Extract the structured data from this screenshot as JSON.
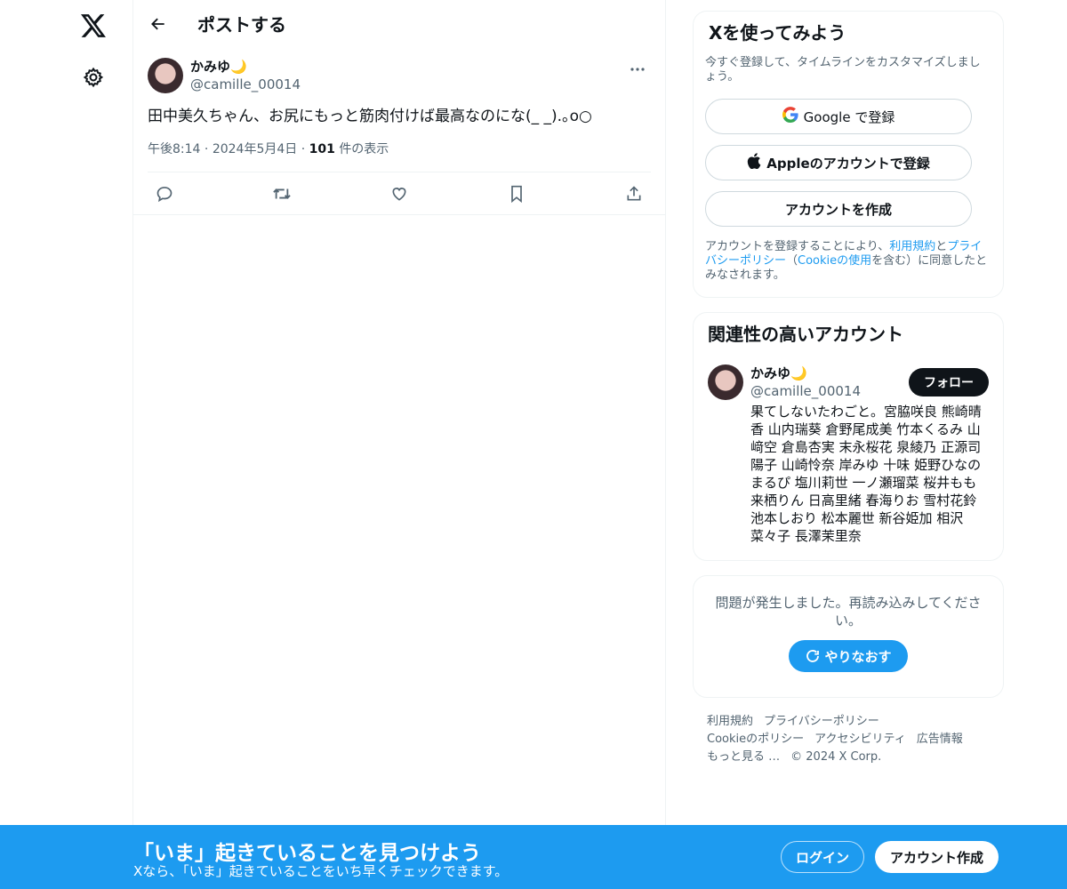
{
  "nav": {
    "logo_icon": "x-logo-icon",
    "settings_icon": "gear-icon"
  },
  "header": {
    "title": "ポストする",
    "back_icon": "arrow-left-icon"
  },
  "tweet": {
    "display_name": "かみゆ🌙",
    "handle": "@camille_00014",
    "text": "田中美久ちゃん、お尻にもっと筋肉付けば最高なのにな(_ _).｡o○",
    "time": "午後8:14",
    "date": "2024年5月4日",
    "sep": "·",
    "views_count": "101",
    "views_label": "件の表示",
    "actions": [
      "reply-icon",
      "retweet-icon",
      "like-icon",
      "bookmark-icon",
      "share-icon"
    ]
  },
  "signup": {
    "title": "Xを使ってみよう",
    "subtitle": "今すぐ登録して、タイムラインをカスタマイズしましょう。",
    "google_label": "Google で登録",
    "apple_label": "Appleのアカウントで登録",
    "create_label": "アカウントを作成",
    "legal_1": "アカウントを登録することにより、",
    "legal_terms": "利用規約",
    "legal_and": "と",
    "legal_privacy": "プライバシーポリシー",
    "legal_2": "（",
    "legal_cookie": "Cookieの使用",
    "legal_3": "を含む）に同意したとみなされます。"
  },
  "related": {
    "title": "関連性の高いアカウント",
    "display_name": "かみゆ🌙",
    "handle": "@camille_00014",
    "follow_label": "フォロー",
    "bio": "果てしないたわごと。宮脇咲良 熊崎晴香 山内瑞葵 倉野尾成美 竹本くるみ 山﨑空 倉島杏実 末永桜花 泉綾乃 正源司陽子 山崎怜奈 岸みゆ 十味 姫野ひなの まるぴ 塩川莉世 一ノ瀬瑠菜 桜井もも 来栖りん 日高里緒 春海りお 雪村花鈴 池本しおり 松本麗世 新谷姫加 相沢菜々子 長澤茉里奈"
  },
  "error": {
    "text": "問題が発生しました。再読み込みしてください。",
    "retry_label": "やりなおす"
  },
  "footer": {
    "links": [
      "利用規約",
      "プライバシーポリシー",
      "Cookieのポリシー",
      "アクセシビリティ",
      "広告情報",
      "もっと見る …",
      "© 2024 X Corp."
    ]
  },
  "banner": {
    "title": "「いま」起きていることを見つけよう",
    "subtitle": "Xなら、「いま」起きていることをいち早くチェックできます。",
    "login_label": "ログイン",
    "create_label": "アカウント作成"
  },
  "colors": {
    "accent": "#1d9bf0",
    "text": "#0f1419",
    "muted": "#536471",
    "border": "#eff3f4"
  }
}
